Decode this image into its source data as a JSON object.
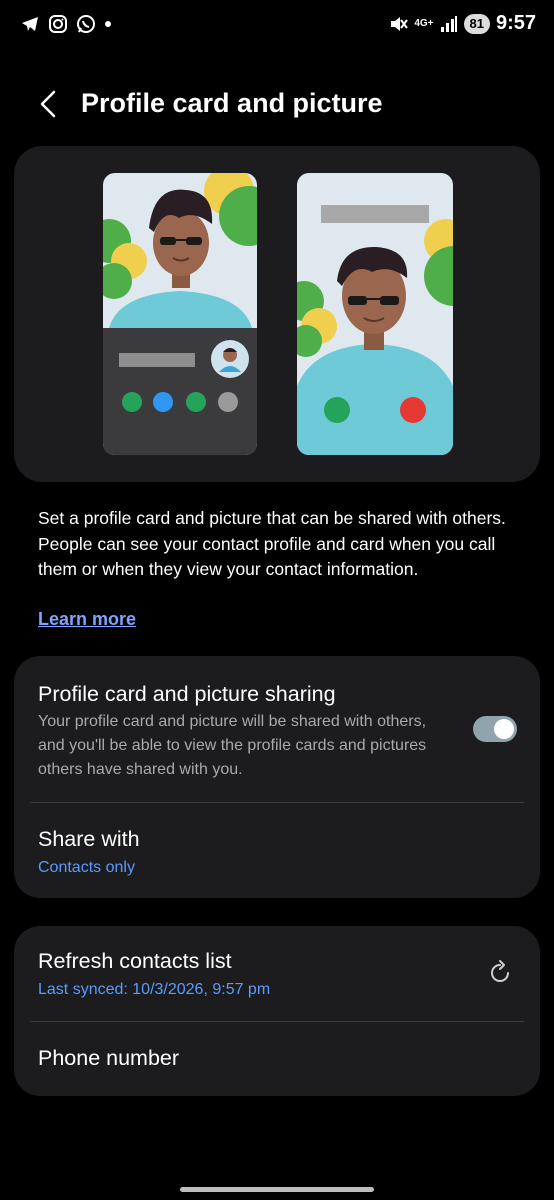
{
  "status_bar": {
    "time": "9:57",
    "battery": "81",
    "network": "4G+",
    "icons": [
      "telegram-icon",
      "instagram-icon",
      "whatsapp-icon",
      "notification-dot-icon",
      "mute-icon",
      "signal-icon"
    ]
  },
  "header": {
    "title": "Profile card and picture"
  },
  "intro": {
    "description": "Set a profile card and picture that can be shared with others. People can see your contact profile and card when you call them or when they view your contact information.",
    "learn_more": "Learn more"
  },
  "sharing_card": {
    "title": "Profile card and picture sharing",
    "description": "Your profile card and picture will be shared with others, and you'll be able to view the profile cards and pictures others have shared with you.",
    "toggle_on": true,
    "share_with_title": "Share with",
    "share_with_value": "Contacts only"
  },
  "contacts_card": {
    "refresh_title": "Refresh contacts list",
    "refresh_sub": "Last synced: 10/3/2026, 9:57 pm",
    "phone_title": "Phone number"
  },
  "colors": {
    "background": "#000000",
    "card": "#1c1c1e",
    "accent_blue": "#5a9bff",
    "link": "#7da4ff",
    "toggle": "#8fa4ad"
  }
}
